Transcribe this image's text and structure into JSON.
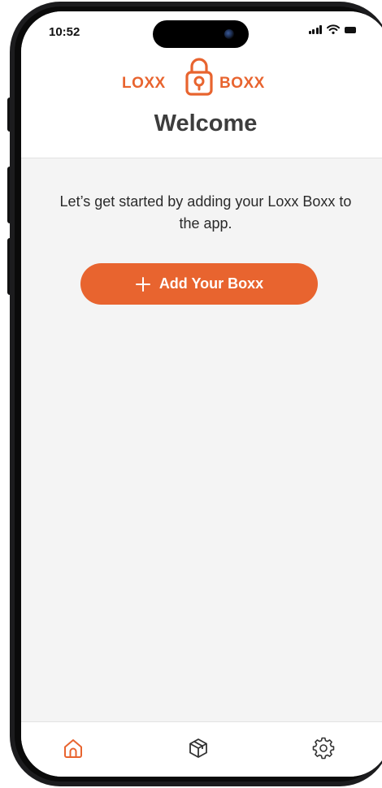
{
  "status_bar": {
    "time": "10:52"
  },
  "brand": {
    "left_word": "LOXX",
    "right_word": "BOXX",
    "lock_icon": "padlock-icon"
  },
  "header": {
    "title": "Welcome"
  },
  "main": {
    "intro_text": "Let’s get started by adding your Loxx Boxx to the app.",
    "add_button": {
      "label": "Add Your Boxx",
      "icon": "plus-icon"
    }
  },
  "tab_bar": {
    "items": [
      {
        "icon": "home-icon",
        "active": true
      },
      {
        "icon": "box-icon",
        "active": false
      },
      {
        "icon": "gear-icon",
        "active": false
      }
    ]
  },
  "colors": {
    "accent": "#e8642f",
    "heading": "#3d3d3d",
    "background": "#f4f4f4",
    "inactive_icon": "#333333"
  }
}
